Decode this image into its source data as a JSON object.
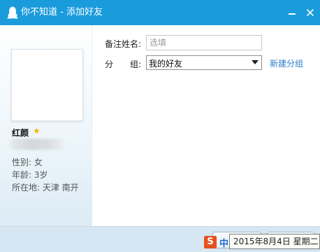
{
  "window": {
    "title": "你不知道 - 添加好友",
    "minimize_symbol": "—",
    "close_symbol": "✕"
  },
  "contact": {
    "nickname": "红颜",
    "star_icon": "★",
    "gender": "性别: 女",
    "age": "年龄: 3岁",
    "location": "所在地: 天津  南开"
  },
  "form": {
    "remark_label": "备注姓名:",
    "remark_placeholder": "选填",
    "remark_value": "",
    "group_label_1": "分",
    "group_label_2": "组:",
    "group_value": "我的好友",
    "new_group_link": "新建分组"
  },
  "taskbar": {
    "ime_icon": "S",
    "ime_mode": "中",
    "date_tooltip": "2015年8月4日 星期二"
  },
  "colors": {
    "titlebar": "#1a9bdc",
    "link": "#2a7fc9",
    "star": "#f5b400",
    "ime": "#e8501e"
  }
}
